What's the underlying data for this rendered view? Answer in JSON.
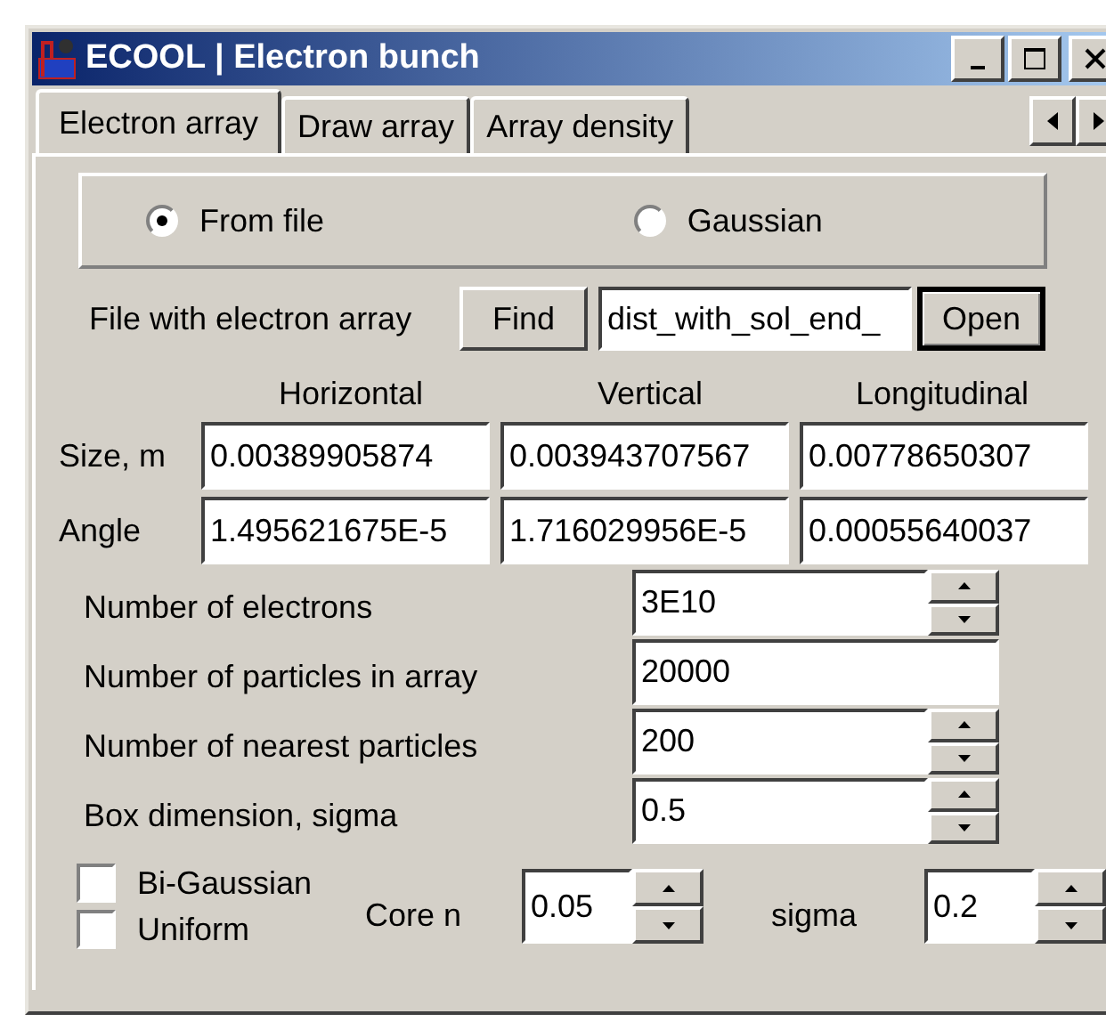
{
  "window": {
    "title": "ECOOL | Electron bunch"
  },
  "tabs": [
    {
      "label": "Electron array",
      "selected": true
    },
    {
      "label": "Draw array",
      "selected": false
    },
    {
      "label": "Array density",
      "selected": false
    }
  ],
  "source_options": [
    {
      "label": "From file",
      "selected": true
    },
    {
      "label": "Gaussian",
      "selected": false
    }
  ],
  "file": {
    "label": "File with electron array",
    "find_button": "Find",
    "value": "dist_with_sol_end_",
    "open_button": "Open"
  },
  "size_table": {
    "columns": [
      "Horizontal",
      "Vertical",
      "Longitudinal"
    ],
    "rows": [
      {
        "label": "Size, m",
        "values": [
          "0.00389905874",
          "0.003943707567",
          "0.00778650307"
        ]
      },
      {
        "label": "Angle",
        "values": [
          "1.495621675E-5",
          "1.716029956E-5",
          "0.00055640037"
        ]
      }
    ]
  },
  "params": [
    {
      "kind": "spin",
      "label": "Number of electrons",
      "value": "3E10"
    },
    {
      "kind": "plain",
      "label": "Number of particles in array",
      "value": "20000"
    },
    {
      "kind": "spin",
      "label": "Number of nearest particles",
      "value": "200"
    },
    {
      "kind": "spin",
      "label": "Box dimension, sigma",
      "value": "0.5"
    }
  ],
  "checkboxes": [
    {
      "label": "Bi-Gaussian",
      "checked": false
    },
    {
      "label": "Uniform",
      "checked": false
    }
  ],
  "core": {
    "label": "Core n",
    "value": "0.05"
  },
  "sigma": {
    "label": "sigma",
    "value": "0.2"
  }
}
